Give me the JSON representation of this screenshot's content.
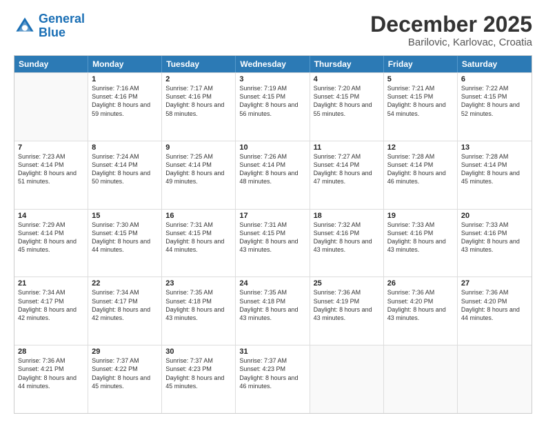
{
  "header": {
    "logo_general": "General",
    "logo_blue": "Blue",
    "month_title": "December 2025",
    "location": "Barilovic, Karlovac, Croatia"
  },
  "weekdays": [
    "Sunday",
    "Monday",
    "Tuesday",
    "Wednesday",
    "Thursday",
    "Friday",
    "Saturday"
  ],
  "rows": [
    [
      {
        "day": "",
        "sunrise": "",
        "sunset": "",
        "daylight": ""
      },
      {
        "day": "1",
        "sunrise": "Sunrise: 7:16 AM",
        "sunset": "Sunset: 4:16 PM",
        "daylight": "Daylight: 8 hours and 59 minutes."
      },
      {
        "day": "2",
        "sunrise": "Sunrise: 7:17 AM",
        "sunset": "Sunset: 4:16 PM",
        "daylight": "Daylight: 8 hours and 58 minutes."
      },
      {
        "day": "3",
        "sunrise": "Sunrise: 7:19 AM",
        "sunset": "Sunset: 4:15 PM",
        "daylight": "Daylight: 8 hours and 56 minutes."
      },
      {
        "day": "4",
        "sunrise": "Sunrise: 7:20 AM",
        "sunset": "Sunset: 4:15 PM",
        "daylight": "Daylight: 8 hours and 55 minutes."
      },
      {
        "day": "5",
        "sunrise": "Sunrise: 7:21 AM",
        "sunset": "Sunset: 4:15 PM",
        "daylight": "Daylight: 8 hours and 54 minutes."
      },
      {
        "day": "6",
        "sunrise": "Sunrise: 7:22 AM",
        "sunset": "Sunset: 4:15 PM",
        "daylight": "Daylight: 8 hours and 52 minutes."
      }
    ],
    [
      {
        "day": "7",
        "sunrise": "Sunrise: 7:23 AM",
        "sunset": "Sunset: 4:14 PM",
        "daylight": "Daylight: 8 hours and 51 minutes."
      },
      {
        "day": "8",
        "sunrise": "Sunrise: 7:24 AM",
        "sunset": "Sunset: 4:14 PM",
        "daylight": "Daylight: 8 hours and 50 minutes."
      },
      {
        "day": "9",
        "sunrise": "Sunrise: 7:25 AM",
        "sunset": "Sunset: 4:14 PM",
        "daylight": "Daylight: 8 hours and 49 minutes."
      },
      {
        "day": "10",
        "sunrise": "Sunrise: 7:26 AM",
        "sunset": "Sunset: 4:14 PM",
        "daylight": "Daylight: 8 hours and 48 minutes."
      },
      {
        "day": "11",
        "sunrise": "Sunrise: 7:27 AM",
        "sunset": "Sunset: 4:14 PM",
        "daylight": "Daylight: 8 hours and 47 minutes."
      },
      {
        "day": "12",
        "sunrise": "Sunrise: 7:28 AM",
        "sunset": "Sunset: 4:14 PM",
        "daylight": "Daylight: 8 hours and 46 minutes."
      },
      {
        "day": "13",
        "sunrise": "Sunrise: 7:28 AM",
        "sunset": "Sunset: 4:14 PM",
        "daylight": "Daylight: 8 hours and 45 minutes."
      }
    ],
    [
      {
        "day": "14",
        "sunrise": "Sunrise: 7:29 AM",
        "sunset": "Sunset: 4:14 PM",
        "daylight": "Daylight: 8 hours and 45 minutes."
      },
      {
        "day": "15",
        "sunrise": "Sunrise: 7:30 AM",
        "sunset": "Sunset: 4:15 PM",
        "daylight": "Daylight: 8 hours and 44 minutes."
      },
      {
        "day": "16",
        "sunrise": "Sunrise: 7:31 AM",
        "sunset": "Sunset: 4:15 PM",
        "daylight": "Daylight: 8 hours and 44 minutes."
      },
      {
        "day": "17",
        "sunrise": "Sunrise: 7:31 AM",
        "sunset": "Sunset: 4:15 PM",
        "daylight": "Daylight: 8 hours and 43 minutes."
      },
      {
        "day": "18",
        "sunrise": "Sunrise: 7:32 AM",
        "sunset": "Sunset: 4:16 PM",
        "daylight": "Daylight: 8 hours and 43 minutes."
      },
      {
        "day": "19",
        "sunrise": "Sunrise: 7:33 AM",
        "sunset": "Sunset: 4:16 PM",
        "daylight": "Daylight: 8 hours and 43 minutes."
      },
      {
        "day": "20",
        "sunrise": "Sunrise: 7:33 AM",
        "sunset": "Sunset: 4:16 PM",
        "daylight": "Daylight: 8 hours and 43 minutes."
      }
    ],
    [
      {
        "day": "21",
        "sunrise": "Sunrise: 7:34 AM",
        "sunset": "Sunset: 4:17 PM",
        "daylight": "Daylight: 8 hours and 42 minutes."
      },
      {
        "day": "22",
        "sunrise": "Sunrise: 7:34 AM",
        "sunset": "Sunset: 4:17 PM",
        "daylight": "Daylight: 8 hours and 42 minutes."
      },
      {
        "day": "23",
        "sunrise": "Sunrise: 7:35 AM",
        "sunset": "Sunset: 4:18 PM",
        "daylight": "Daylight: 8 hours and 43 minutes."
      },
      {
        "day": "24",
        "sunrise": "Sunrise: 7:35 AM",
        "sunset": "Sunset: 4:18 PM",
        "daylight": "Daylight: 8 hours and 43 minutes."
      },
      {
        "day": "25",
        "sunrise": "Sunrise: 7:36 AM",
        "sunset": "Sunset: 4:19 PM",
        "daylight": "Daylight: 8 hours and 43 minutes."
      },
      {
        "day": "26",
        "sunrise": "Sunrise: 7:36 AM",
        "sunset": "Sunset: 4:20 PM",
        "daylight": "Daylight: 8 hours and 43 minutes."
      },
      {
        "day": "27",
        "sunrise": "Sunrise: 7:36 AM",
        "sunset": "Sunset: 4:20 PM",
        "daylight": "Daylight: 8 hours and 44 minutes."
      }
    ],
    [
      {
        "day": "28",
        "sunrise": "Sunrise: 7:36 AM",
        "sunset": "Sunset: 4:21 PM",
        "daylight": "Daylight: 8 hours and 44 minutes."
      },
      {
        "day": "29",
        "sunrise": "Sunrise: 7:37 AM",
        "sunset": "Sunset: 4:22 PM",
        "daylight": "Daylight: 8 hours and 45 minutes."
      },
      {
        "day": "30",
        "sunrise": "Sunrise: 7:37 AM",
        "sunset": "Sunset: 4:23 PM",
        "daylight": "Daylight: 8 hours and 45 minutes."
      },
      {
        "day": "31",
        "sunrise": "Sunrise: 7:37 AM",
        "sunset": "Sunset: 4:23 PM",
        "daylight": "Daylight: 8 hours and 46 minutes."
      },
      {
        "day": "",
        "sunrise": "",
        "sunset": "",
        "daylight": ""
      },
      {
        "day": "",
        "sunrise": "",
        "sunset": "",
        "daylight": ""
      },
      {
        "day": "",
        "sunrise": "",
        "sunset": "",
        "daylight": ""
      }
    ]
  ]
}
